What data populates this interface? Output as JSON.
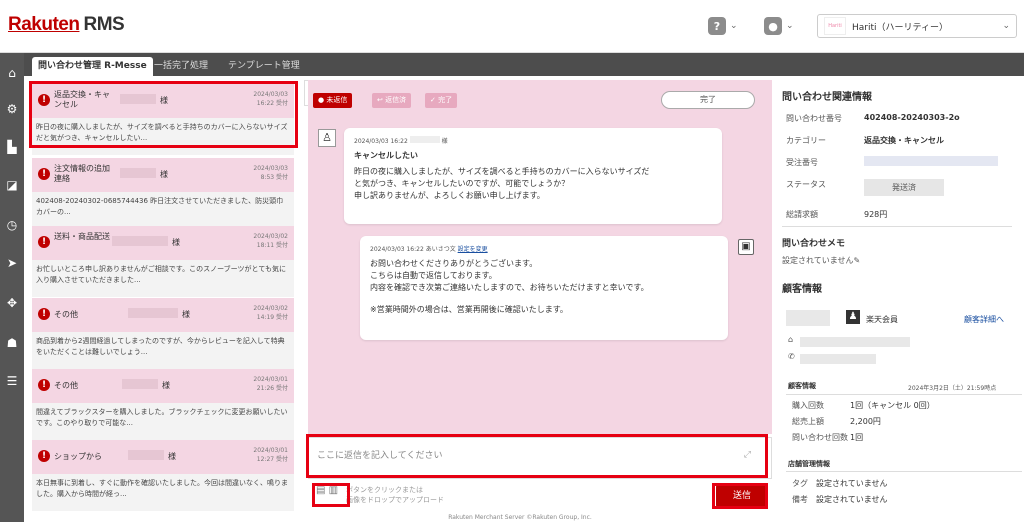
{
  "header": {
    "logo_main": "Rakuten",
    "logo_sub": "RMS",
    "help_icon": "?",
    "user_icon": "●",
    "shop_name": "Hariti（ハーリティー）",
    "shop_logo_text": "Hariti"
  },
  "tabs": [
    {
      "label": "問い合わせ管理 R-Messe"
    },
    {
      "label": "一括完了処理"
    },
    {
      "label": "テンプレート管理"
    }
  ],
  "cards": [
    {
      "cat": "返品交換・キャンセル",
      "suffix": "様",
      "date": "2024/03/03",
      "time": "16:22 受付",
      "body": "昨日の夜に購入しましたが、サイズを調べると手持ちのカバーに入らないサイズだと気がつき、キャンセルしたい..."
    },
    {
      "cat": "注文情報の追加連絡",
      "suffix": "様",
      "date": "2024/03/03",
      "time": "8:53 受付",
      "body": "402408-20240302-0685744436 昨日注文させていただきました、防災頭巾カバーの..."
    },
    {
      "cat": "送料・商品配送",
      "suffix": "様",
      "date": "2024/03/02",
      "time": "18:11 受付",
      "body": "お忙しいところ申し訳ありませんがご相談です。このスノーブーツがとても気に入り購入させていただきました..."
    },
    {
      "cat": "その他",
      "suffix": "様",
      "date": "2024/03/02",
      "time": "14:19 受付",
      "body": "商品到着から2週間経過してしまったのですが、今からレビューを記入して特典をいただくことは難しいでしょう..."
    },
    {
      "cat": "その他",
      "suffix": "様",
      "date": "2024/03/01",
      "time": "21:26 受付",
      "body": "間違えてブラックスターを購入しました。ブラックチェックに変更お願いしたいです。このやり取りで可能な..."
    },
    {
      "cat": "ショップから",
      "suffix": "様",
      "date": "2024/03/01",
      "time": "12:27 受付",
      "body": "本日無事に到着し、すぐに動作を確認いたしました。今回は間違いなく、鳴りました。購入から時間が経っ..."
    }
  ],
  "chat": {
    "status_unreplied": "未返信",
    "status_replied": "返信済",
    "status_done": "完了",
    "done_button": "完了",
    "msg1_meta": "2024/03/03 16:22",
    "msg1_suffix": "様",
    "msg1_title": "キャンセルしたい",
    "msg1_body1": "昨日の夜に購入しましたが、サイズを調べると手持ちのカバーに入らないサイズだ",
    "msg1_body2": "と気がつき、キャンセルしたいのですが、可能でしょうか？",
    "msg1_body3": "申し訳ありませんが、よろしくお願い申し上げます。",
    "msg2_meta": "2024/03/03 16:22 あいさつ文",
    "msg2_link": "設定を変更",
    "msg2_l1": "お問い合わせくださりありがとうございます。",
    "msg2_l2": "こちらは自動で返信しております。",
    "msg2_l3": "内容を確認でき次第ご連絡いたしますので、お待ちいただけますと幸いです。",
    "msg2_l4": "※営業時間外の場合は、営業再開後に確認いたします。",
    "input_placeholder": "ここに返信を記入してください",
    "upload_l1": "ボタンをクリックまたは",
    "upload_l2": "画像をドロップでアップロード",
    "send": "送信"
  },
  "right": {
    "title": "問い合わせ関連情報",
    "f_no_label": "問い合わせ番号",
    "f_no_val": "402408-20240303-2o",
    "f_cat_label": "カテゴリー",
    "f_cat_val": "返品交換・キャンセル",
    "f_order_label": "受注番号",
    "f_status_label": "ステータス",
    "f_status_val": "発送済",
    "f_total_label": "総請求額",
    "f_total_val": "928円",
    "memo_title": "問い合わせメモ",
    "memo_val": "設定されていません",
    "cust_title": "顧客情報",
    "member": "楽天会員",
    "detail_link": "顧客詳細へ",
    "cust_sub": "顧客情報",
    "cust_date": "2024年3月2日（土）21:59時点",
    "buy_label": "購入回数",
    "buy_val": "1回（キャンセル 0回）",
    "sales_label": "総売上額",
    "sales_val": "2,200円",
    "inq_label": "問い合わせ回数",
    "inq_val": "1回",
    "shop_title": "店舗管理情報",
    "tag_label": "タグ",
    "tag_val": "設定されていません",
    "note_label": "備考",
    "note_val": "設定されていません"
  },
  "footer": "Rakuten Merchant Server ©Rakuten Group, Inc."
}
